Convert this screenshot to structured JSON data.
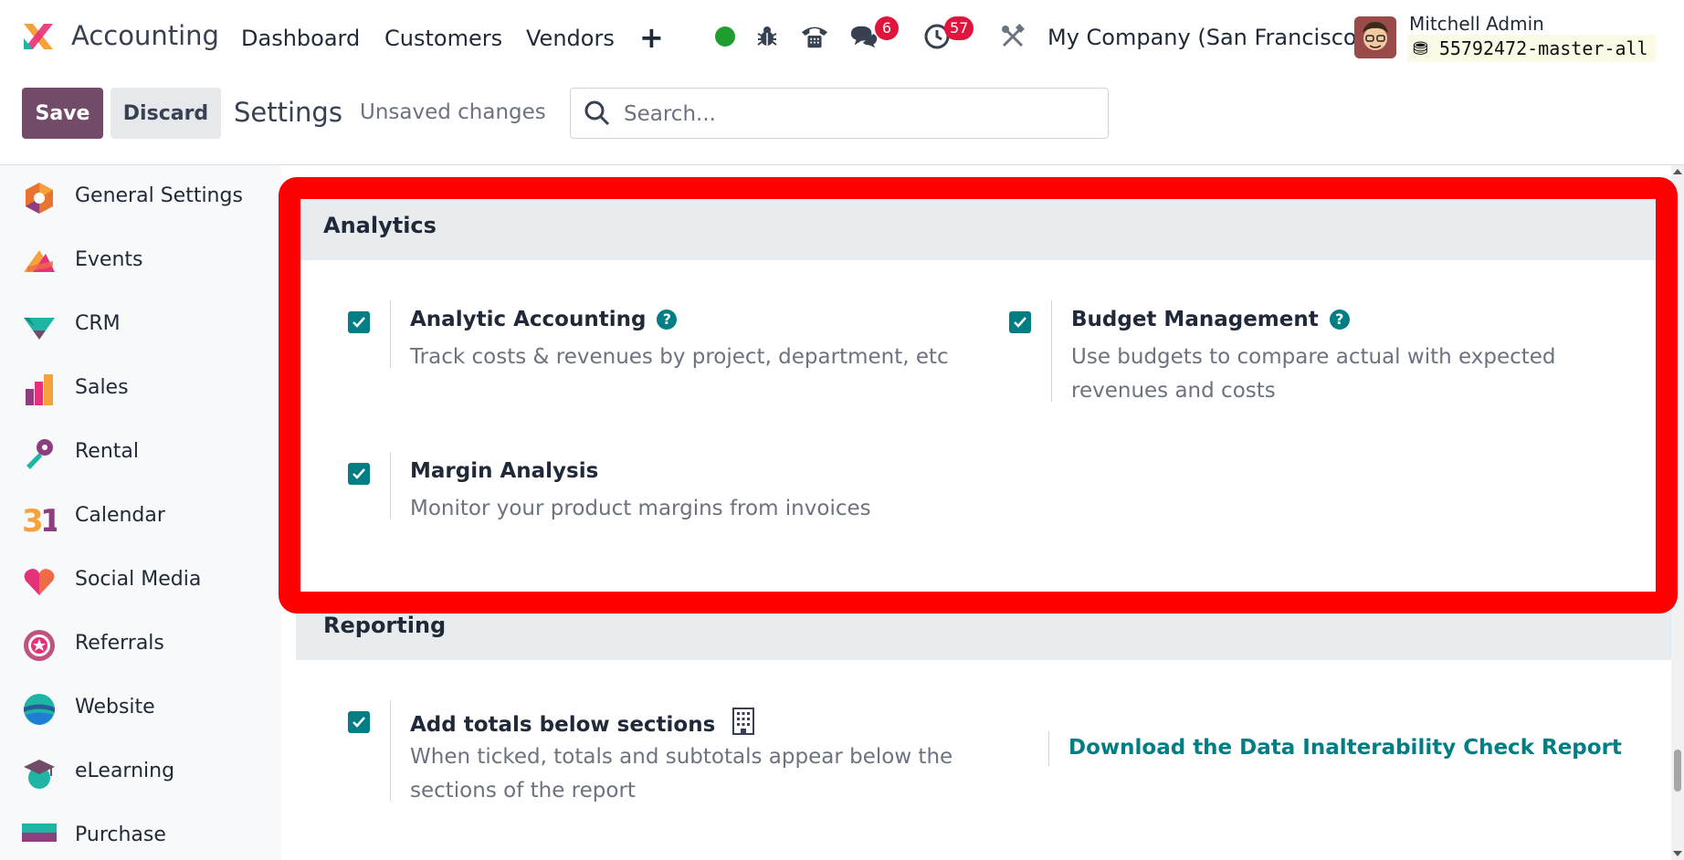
{
  "topbar": {
    "app_name": "Accounting",
    "nav": [
      "Dashboard",
      "Customers",
      "Vendors"
    ],
    "chat_badge": "6",
    "activity_badge": "57",
    "company": "My Company (San Francisco)",
    "user_name": "Mitchell Admin",
    "database": "55792472-master-all"
  },
  "control": {
    "save_label": "Save",
    "discard_label": "Discard",
    "title": "Settings",
    "status": "Unsaved changes",
    "search_placeholder": "Search..."
  },
  "sidebar": {
    "items": [
      {
        "label": "General Settings",
        "icon": "general-settings-icon"
      },
      {
        "label": "Events",
        "icon": "events-icon"
      },
      {
        "label": "CRM",
        "icon": "crm-icon"
      },
      {
        "label": "Sales",
        "icon": "sales-icon"
      },
      {
        "label": "Rental",
        "icon": "rental-icon"
      },
      {
        "label": "Calendar",
        "icon": "calendar-icon"
      },
      {
        "label": "Social Media",
        "icon": "social-media-icon"
      },
      {
        "label": "Referrals",
        "icon": "referrals-icon"
      },
      {
        "label": "Website",
        "icon": "website-icon"
      },
      {
        "label": "eLearning",
        "icon": "elearning-icon"
      },
      {
        "label": "Purchase",
        "icon": "purchase-icon"
      }
    ]
  },
  "analytics": {
    "title": "Analytics",
    "settings": [
      {
        "title": "Analytic Accounting",
        "description": "Track costs & revenues by project, department, etc",
        "checked": true
      },
      {
        "title": "Budget Management",
        "description": "Use budgets to compare actual with expected revenues and costs",
        "checked": true
      },
      {
        "title": "Margin Analysis",
        "description": "Monitor your product margins from invoices",
        "checked": true
      }
    ]
  },
  "reporting": {
    "title": "Reporting",
    "totals_title": "Add totals below sections",
    "totals_description": "When ticked, totals and subtotals appear below the sections of the report",
    "totals_checked": true,
    "inalterability_link": "Download the Data Inalterability Check Report"
  },
  "colors": {
    "brand": "#714b67",
    "accent": "#017e84",
    "badge": "#e0143c",
    "highlight": "#ff0000"
  }
}
